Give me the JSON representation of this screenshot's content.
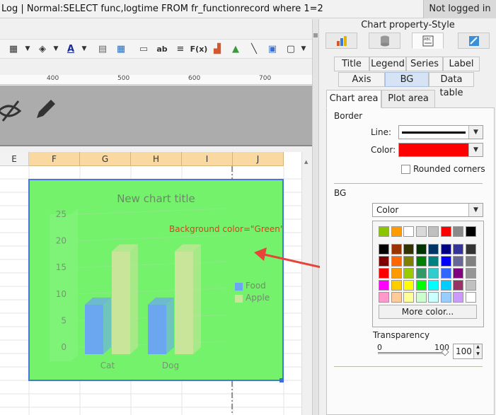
{
  "statusbar": {
    "log_text": "Log | Normal:SELECT func,logtime FROM fr_functionrecord where 1=2",
    "login_status": "Not logged in"
  },
  "ruler": {
    "ticks": [
      "400",
      "500",
      "600",
      "700"
    ]
  },
  "columns": [
    "E",
    "F",
    "G",
    "H",
    "I",
    "J"
  ],
  "chart": {
    "title": "New chart title",
    "annotation": "Background color=\"Green\"",
    "background_color": "#74f26c",
    "type": "bar",
    "y_ticks": [
      "25",
      "20",
      "15",
      "10",
      "5",
      "0"
    ],
    "categories": [
      "Cat",
      "Dog"
    ],
    "series": [
      {
        "name": "Food",
        "values": [
          8,
          8
        ],
        "color": "#6ba7f0"
      },
      {
        "name": "Apple",
        "values": [
          18,
          18
        ],
        "color": "#c8e59a"
      }
    ],
    "ylim": [
      0,
      25
    ]
  },
  "chart_data": {
    "type": "bar",
    "title": "New chart title",
    "categories": [
      "Cat",
      "Dog"
    ],
    "series": [
      {
        "name": "Food",
        "values": [
          8,
          8
        ]
      },
      {
        "name": "Apple",
        "values": [
          18,
          18
        ]
      }
    ],
    "ylim": [
      0,
      25
    ],
    "legend": "right"
  },
  "right_pane": {
    "title": "Chart property-Style",
    "icon_tabs": [
      "chart-type-icon",
      "data-icon",
      "style-icon",
      "effects-icon"
    ],
    "tabs_row1": [
      "Title",
      "Legend",
      "Series",
      "Label"
    ],
    "tabs_row2": [
      "Axis",
      "BG",
      "Data table"
    ],
    "subtabs": [
      "Chart area",
      "Plot area"
    ],
    "border_section": "Border",
    "line_label": "Line:",
    "color_label": "Color:",
    "border_color": "#ff0000",
    "rounded_corners": "Rounded corners",
    "bg_section": "BG",
    "bg_type": "Color",
    "more_color": "More color...",
    "transparency_label": "Transparency",
    "slider_min": "0",
    "slider_max": "100",
    "transparency_value": "100"
  },
  "palette": {
    "top_row": [
      "#8bc400",
      "#ff9a00",
      "#ffffff",
      "#d9d9d9",
      "#bfbfbf",
      "#ff0000",
      "#8a8a8a",
      "#000000"
    ],
    "grid": [
      [
        "#000000",
        "#993300",
        "#333300",
        "#003300",
        "#003366",
        "#000080",
        "#333399",
        "#333333"
      ],
      [
        "#800000",
        "#ff6600",
        "#808000",
        "#008000",
        "#008080",
        "#0000ff",
        "#666699",
        "#808080"
      ],
      [
        "#ff0000",
        "#ff9900",
        "#99cc00",
        "#339966",
        "#33cccc",
        "#3366ff",
        "#800080",
        "#969696"
      ],
      [
        "#ff00ff",
        "#ffcc00",
        "#ffff00",
        "#00ff00",
        "#00ffff",
        "#00ccff",
        "#993366",
        "#c0c0c0"
      ],
      [
        "#ff99cc",
        "#ffcc99",
        "#ffff99",
        "#ccffcc",
        "#ccffff",
        "#99ccff",
        "#cc99ff",
        "#ffffff"
      ]
    ]
  }
}
